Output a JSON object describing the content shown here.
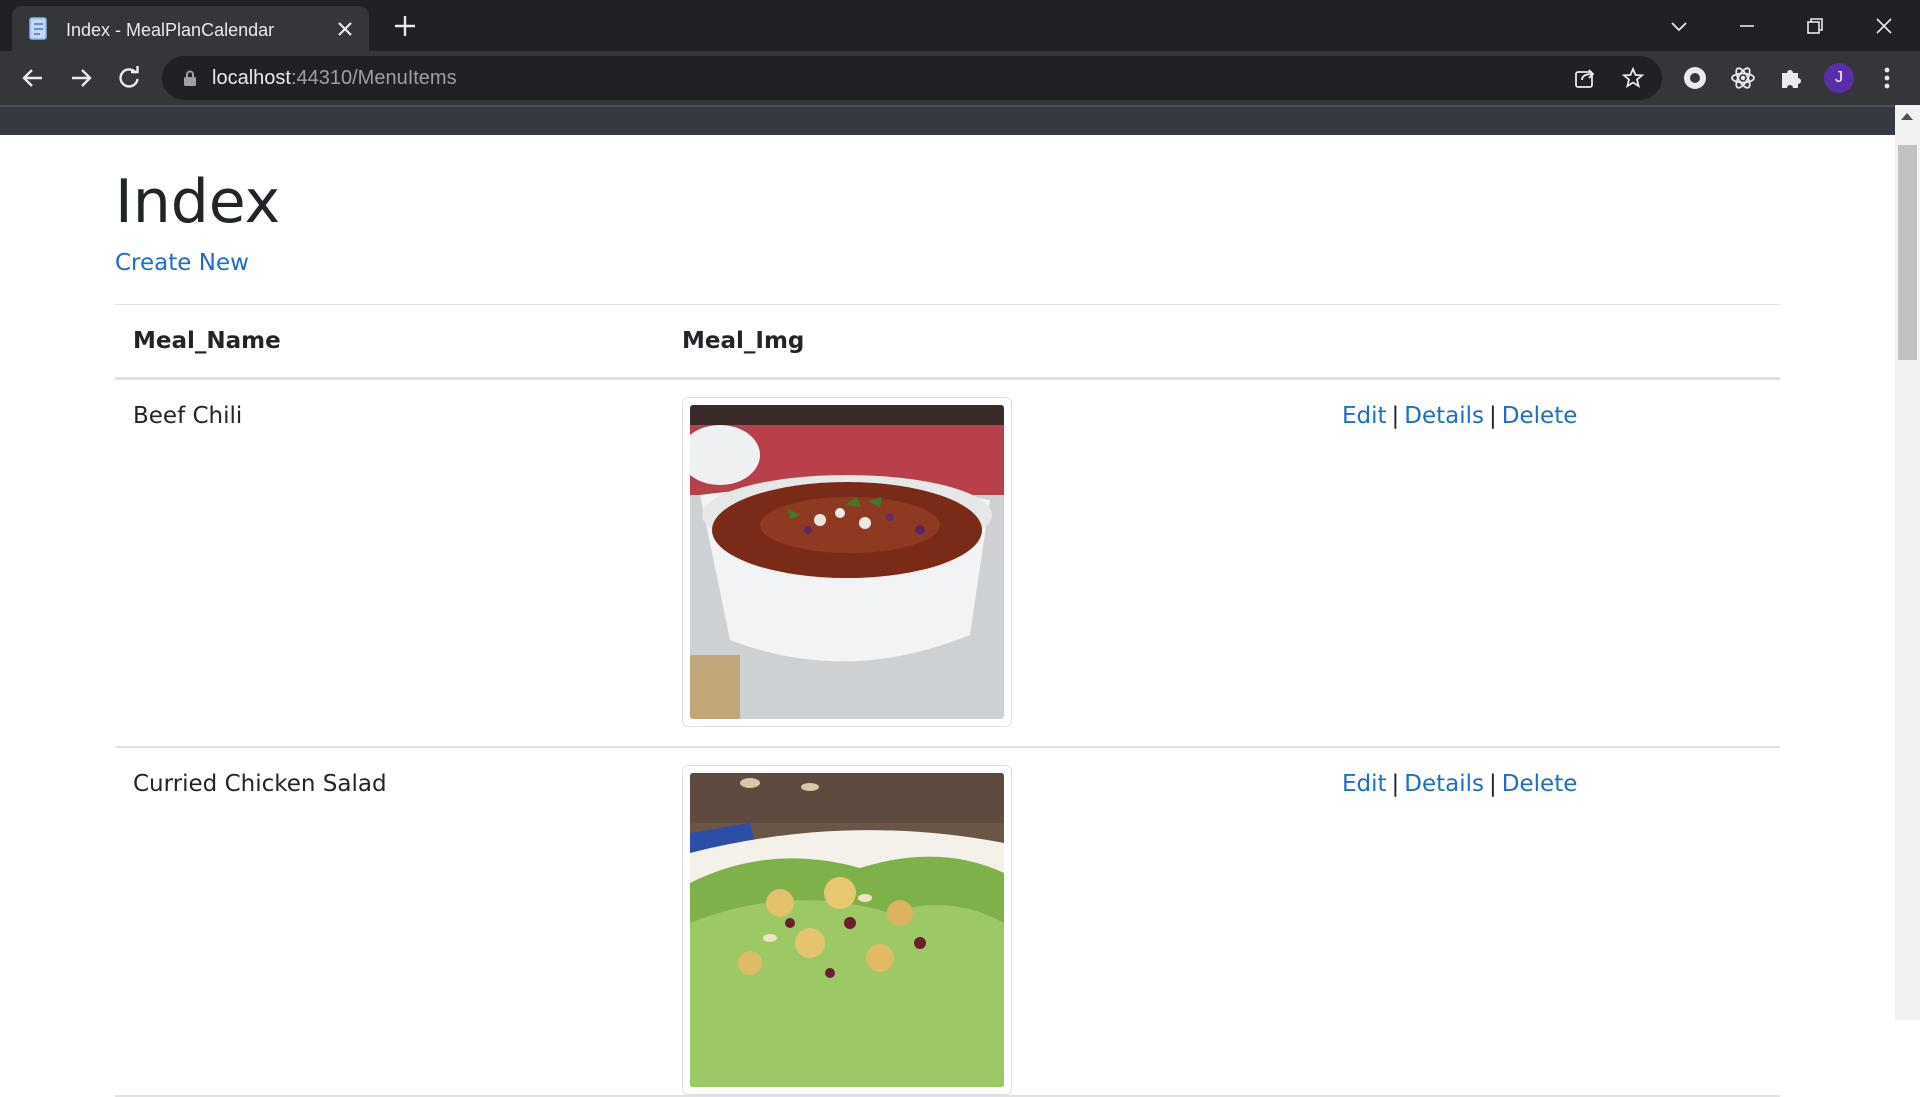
{
  "browser": {
    "tab_title": "Index - MealPlanCalendar",
    "url_host": "localhost",
    "url_rest": ":44310/MenuItems",
    "avatar_letter": "J"
  },
  "page": {
    "heading": "Index",
    "create_link": "Create New",
    "columns": [
      "Meal_Name",
      "Meal_Img"
    ],
    "rows": [
      {
        "name": "Beef Chili",
        "image": "beef-chili-photo"
      },
      {
        "name": "Curried Chicken Salad",
        "image": "curried-chicken-salad-photo"
      }
    ],
    "actions": {
      "edit": "Edit",
      "details": "Details",
      "delete": "Delete",
      "separator": "|"
    }
  },
  "colors": {
    "link": "#1b6ec2",
    "navbar": "#343a40",
    "chrome_dark": "#202124",
    "chrome": "#35363a"
  }
}
